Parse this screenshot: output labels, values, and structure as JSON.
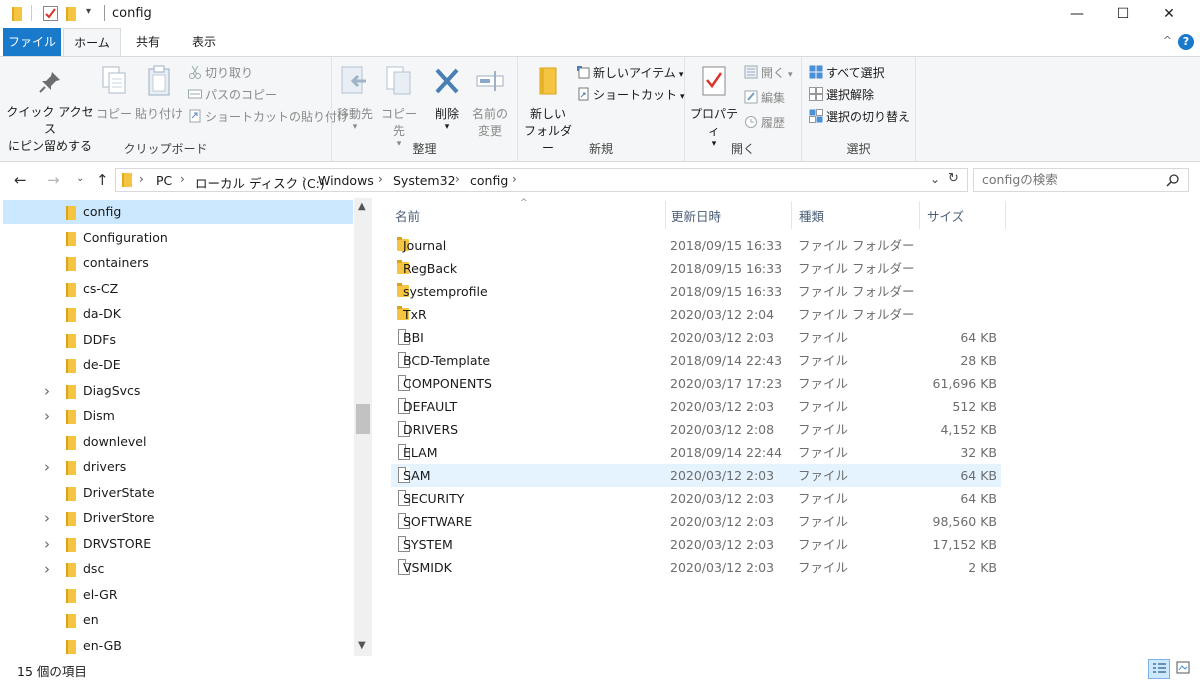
{
  "window": {
    "title": "config",
    "minimize": "—",
    "maximize": "☐",
    "close": "✕"
  },
  "ribbon_tabs": {
    "file": "ファイル",
    "home": "ホーム",
    "share": "共有",
    "view": "表示"
  },
  "help": "?",
  "collapse": "^",
  "ribbon": {
    "clipboard": {
      "label": "クリップボード",
      "pin_line1": "クイック アクセス",
      "pin_line2": "にピン留めする",
      "copy": "コピー",
      "paste": "貼り付け",
      "cut": "切り取り",
      "copy_path": "パスのコピー",
      "paste_shortcut": "ショートカットの貼り付け"
    },
    "organize": {
      "label": "整理",
      "move_to": "移動先",
      "copy_to": "コピー先",
      "delete": "削除",
      "rename_line1": "名前の",
      "rename_line2": "変更"
    },
    "new": {
      "label": "新規",
      "new_folder_line1": "新しい",
      "new_folder_line2": "フォルダー",
      "new_item": "新しいアイテム",
      "shortcut": "ショートカット"
    },
    "open": {
      "label": "開く",
      "properties": "プロパティ",
      "open": "開く",
      "edit": "編集",
      "history": "履歴"
    },
    "select": {
      "label": "選択",
      "select_all": "すべて選択",
      "select_none": "選択解除",
      "invert": "選択の切り替え"
    }
  },
  "address": {
    "crumbs": [
      "PC",
      "ローカル ディスク (C:)",
      "Windows",
      "System32",
      "config"
    ],
    "search_placeholder": "configの検索"
  },
  "nav_tree": [
    {
      "label": "config",
      "expandable": false,
      "selected": true
    },
    {
      "label": "Configuration",
      "expandable": false
    },
    {
      "label": "containers",
      "expandable": false
    },
    {
      "label": "cs-CZ",
      "expandable": false
    },
    {
      "label": "da-DK",
      "expandable": false
    },
    {
      "label": "DDFs",
      "expandable": false
    },
    {
      "label": "de-DE",
      "expandable": false
    },
    {
      "label": "DiagSvcs",
      "expandable": true
    },
    {
      "label": "Dism",
      "expandable": true
    },
    {
      "label": "downlevel",
      "expandable": false
    },
    {
      "label": "drivers",
      "expandable": true
    },
    {
      "label": "DriverState",
      "expandable": false
    },
    {
      "label": "DriverStore",
      "expandable": true
    },
    {
      "label": "DRVSTORE",
      "expandable": true
    },
    {
      "label": "dsc",
      "expandable": true
    },
    {
      "label": "el-GR",
      "expandable": false
    },
    {
      "label": "en",
      "expandable": false
    },
    {
      "label": "en-GB",
      "expandable": false
    }
  ],
  "columns": {
    "name": "名前",
    "modified": "更新日時",
    "type": "種類",
    "size": "サイズ"
  },
  "files": [
    {
      "name": "Journal",
      "modified": "2018/09/15 16:33",
      "type": "ファイル フォルダー",
      "size": "",
      "kind": "folder"
    },
    {
      "name": "RegBack",
      "modified": "2018/09/15 16:33",
      "type": "ファイル フォルダー",
      "size": "",
      "kind": "folder"
    },
    {
      "name": "systemprofile",
      "modified": "2018/09/15 16:33",
      "type": "ファイル フォルダー",
      "size": "",
      "kind": "folder"
    },
    {
      "name": "TxR",
      "modified": "2020/03/12 2:04",
      "type": "ファイル フォルダー",
      "size": "",
      "kind": "folder"
    },
    {
      "name": "BBI",
      "modified": "2020/03/12 2:03",
      "type": "ファイル",
      "size": "64 KB",
      "kind": "file"
    },
    {
      "name": "BCD-Template",
      "modified": "2018/09/14 22:43",
      "type": "ファイル",
      "size": "28 KB",
      "kind": "file"
    },
    {
      "name": "COMPONENTS",
      "modified": "2020/03/17 17:23",
      "type": "ファイル",
      "size": "61,696 KB",
      "kind": "file"
    },
    {
      "name": "DEFAULT",
      "modified": "2020/03/12 2:03",
      "type": "ファイル",
      "size": "512 KB",
      "kind": "file"
    },
    {
      "name": "DRIVERS",
      "modified": "2020/03/12 2:08",
      "type": "ファイル",
      "size": "4,152 KB",
      "kind": "file"
    },
    {
      "name": "ELAM",
      "modified": "2018/09/14 22:44",
      "type": "ファイル",
      "size": "32 KB",
      "kind": "file"
    },
    {
      "name": "SAM",
      "modified": "2020/03/12 2:03",
      "type": "ファイル",
      "size": "64 KB",
      "kind": "file",
      "hover": true
    },
    {
      "name": "SECURITY",
      "modified": "2020/03/12 2:03",
      "type": "ファイル",
      "size": "64 KB",
      "kind": "file"
    },
    {
      "name": "SOFTWARE",
      "modified": "2020/03/12 2:03",
      "type": "ファイル",
      "size": "98,560 KB",
      "kind": "file"
    },
    {
      "name": "SYSTEM",
      "modified": "2020/03/12 2:03",
      "type": "ファイル",
      "size": "17,152 KB",
      "kind": "file"
    },
    {
      "name": "VSMIDK",
      "modified": "2020/03/12 2:03",
      "type": "ファイル",
      "size": "2 KB",
      "kind": "file"
    }
  ],
  "status": {
    "item_count": "15 個の項目"
  },
  "colors": {
    "accent": "#1979ca",
    "selection": "#cce8ff",
    "hover": "#e5f3ff",
    "folder": "#f5c542"
  }
}
